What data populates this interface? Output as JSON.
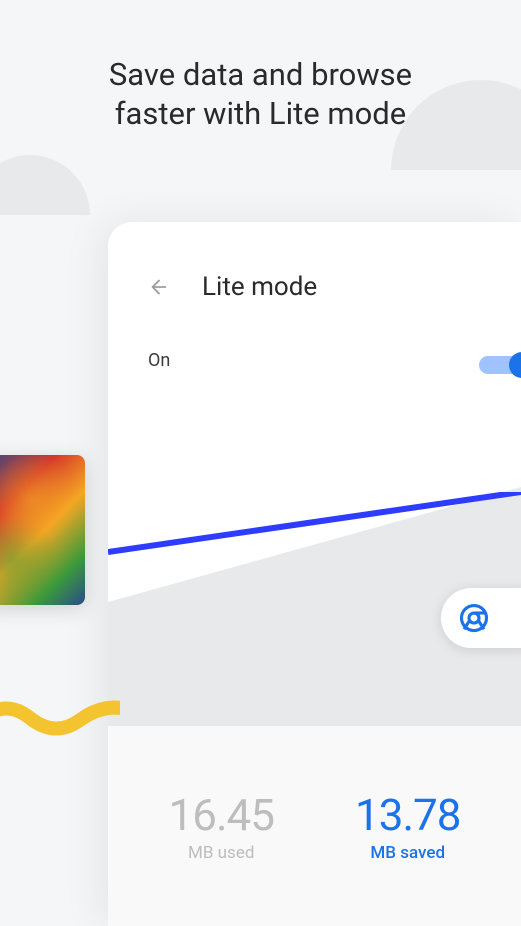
{
  "heading_line1": "Save data and browse",
  "heading_line2": "faster with Lite mode",
  "card": {
    "title": "Lite mode",
    "toggle_label": "On",
    "toggle_state": true
  },
  "stats": {
    "used_value": "16.45",
    "used_label": "MB used",
    "saved_value": "13.78",
    "saved_label": "MB saved"
  },
  "colors": {
    "accent": "#1a73e8",
    "muted": "#bdbdbd"
  }
}
